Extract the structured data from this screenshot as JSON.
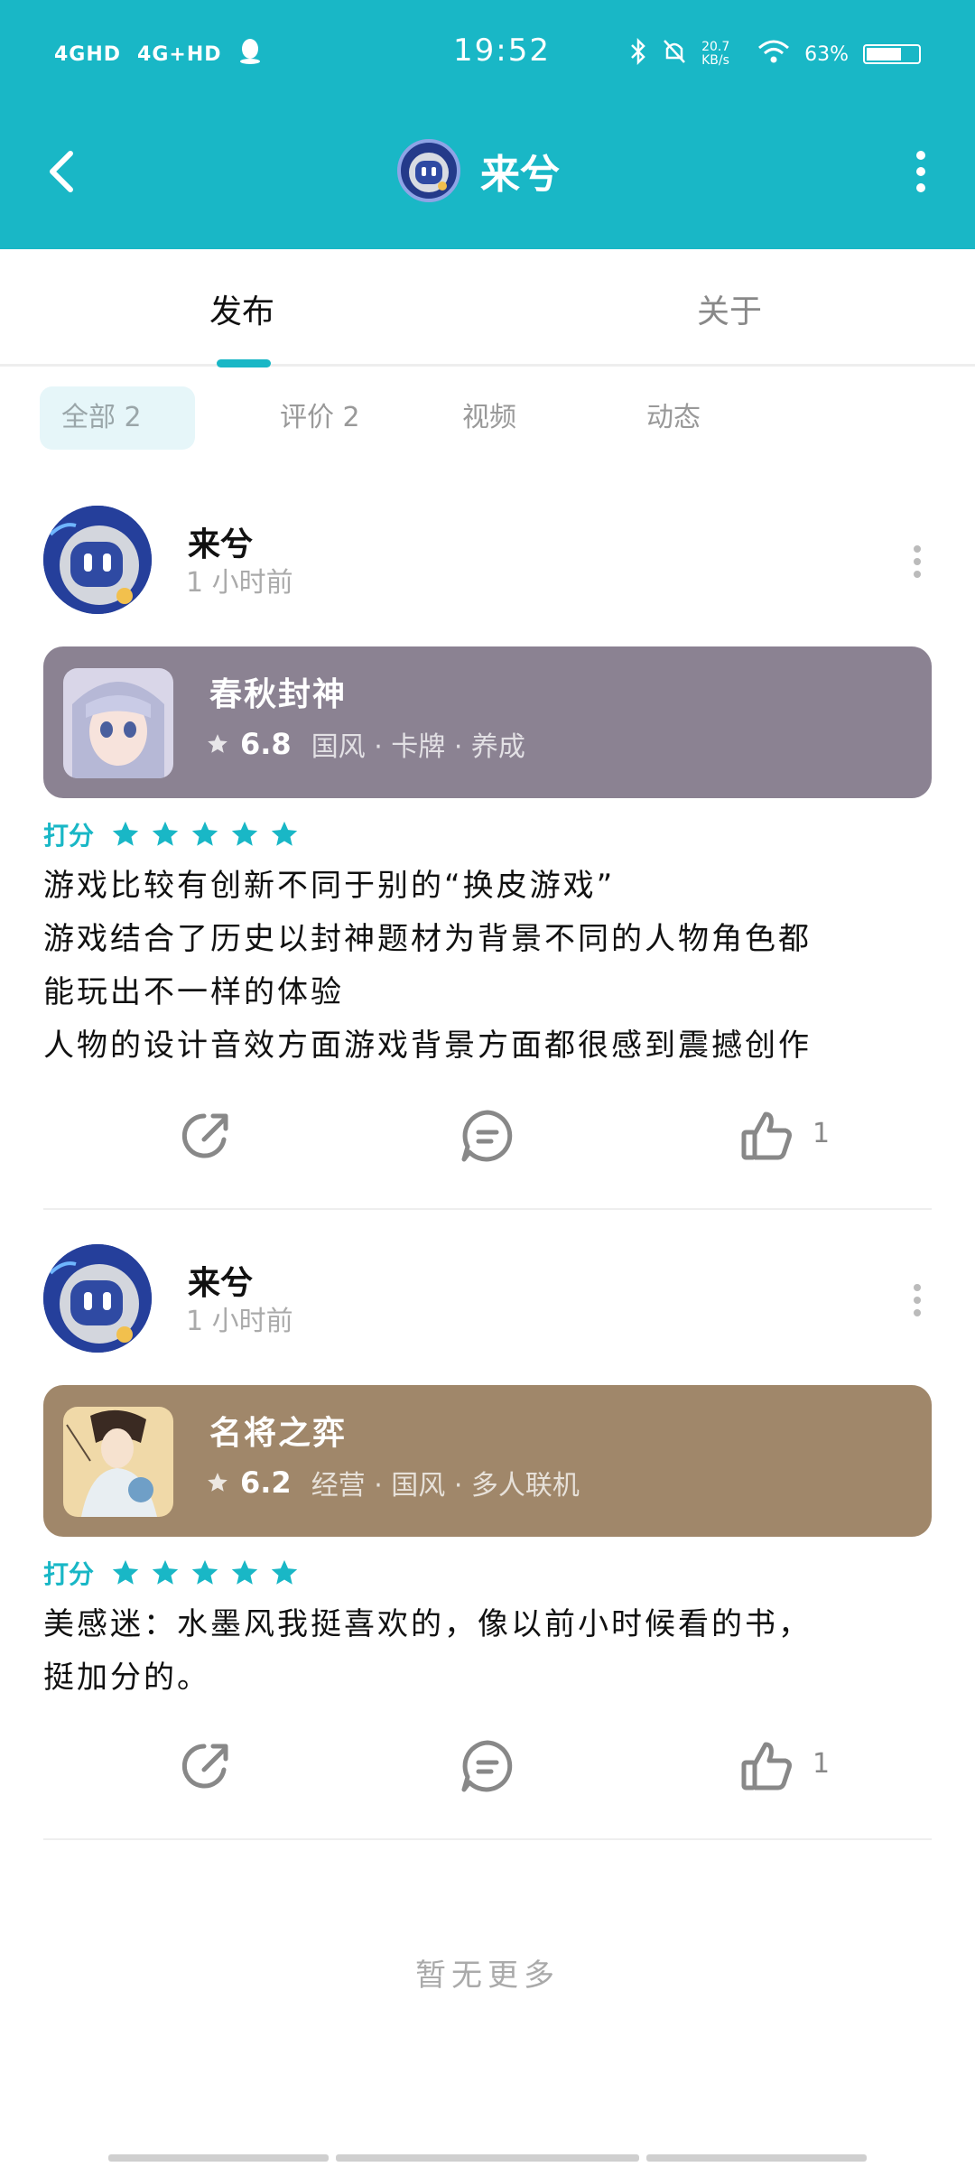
{
  "status_bar": {
    "network_1": "4GHD",
    "network_2": "4G+HD",
    "time": "19:52",
    "speed": "20.7 KB/s",
    "battery": "63%"
  },
  "nav": {
    "title": "来兮"
  },
  "tabs": [
    {
      "label": "发布",
      "active": true
    },
    {
      "label": "关于",
      "active": false
    }
  ],
  "filters": {
    "all": "全部 2",
    "review": "评价 2",
    "video": "视频",
    "moment": "动态"
  },
  "posts": [
    {
      "user": "来兮",
      "time": "1 小时前",
      "game": {
        "name": "春秋封神",
        "score": "6.8",
        "tags": "国风 · 卡牌 · 养成",
        "card_color": "#8b8292"
      },
      "rating_label": "打分",
      "stars": 5,
      "body": [
        "游戏比较有创新不同于别的“换皮游戏”",
        "游戏结合了历史以封神题材为背景不同的人物角色都",
        "能玩出不一样的体验",
        "人物的设计音效方面游戏背景方面都很感到震撼创作"
      ],
      "likes": "1"
    },
    {
      "user": "来兮",
      "time": "1 小时前",
      "game": {
        "name": "名将之弈",
        "score": "6.2",
        "tags": "经营 · 国风 · 多人联机",
        "card_color": "#a0876a"
      },
      "rating_label": "打分",
      "stars": 5,
      "body": [
        "美感迷：水墨风我挺喜欢的，像以前小时候看的书，",
        "挺加分的。"
      ],
      "likes": "1"
    }
  ],
  "footer": {
    "no_more": "暂无更多"
  },
  "colors": {
    "accent": "#19b7c6",
    "header_bg": "#19b7c6"
  }
}
